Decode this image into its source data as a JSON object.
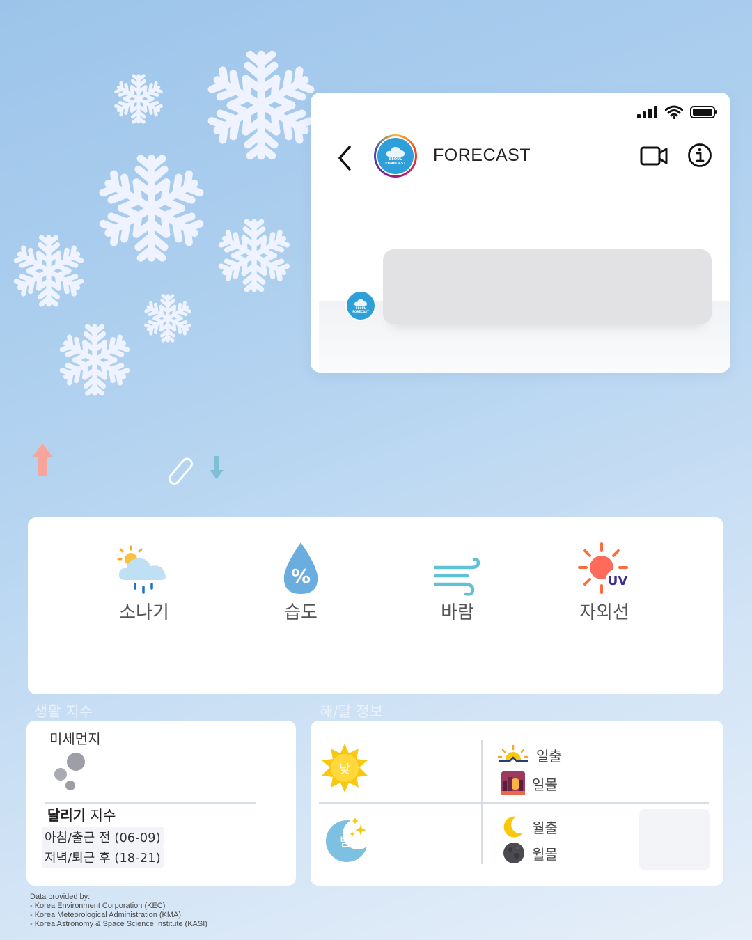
{
  "phone": {
    "title": "FORECAST",
    "avatar_line1": "SEOUL",
    "avatar_line2": "FORECAST"
  },
  "weather": {
    "items": [
      {
        "label": "소나기",
        "icon": "shower-icon"
      },
      {
        "label": "습도",
        "icon": "humidity-drop-icon",
        "glyph": "%"
      },
      {
        "label": "바람",
        "icon": "wind-icon"
      },
      {
        "label": "자외선",
        "icon": "uv-sun-icon",
        "glyph": "UV"
      }
    ]
  },
  "living": {
    "section_label": "생활 지수",
    "dust_title": "미세먼지",
    "run_title_bold": "달리기",
    "run_title_rest": " 지수",
    "run_morning": "아침/출근 전 (06-09)",
    "run_evening": "저녁/퇴근 후 (18-21)"
  },
  "sunmoon": {
    "section_label": "해/달 정보",
    "day_label": "낮",
    "night_label": "밤",
    "sunrise": "일출",
    "sunset": "일몰",
    "moonrise": "월출",
    "moonset": "월몰"
  },
  "footer": {
    "line1": "Data provided by:",
    "line2": "- Korea Environment Corporation (KEC)",
    "line3": "- Korea Meteorological Administration (KMA)",
    "line4": "- Korea Astronomy & Space Science Institute (KASI)"
  },
  "colors": {
    "snowflake": "#eef3ff",
    "arrow_up": "#f7a59a",
    "arrow_down": "#7fbfd6",
    "brand_blue": "#2e9fd8"
  }
}
